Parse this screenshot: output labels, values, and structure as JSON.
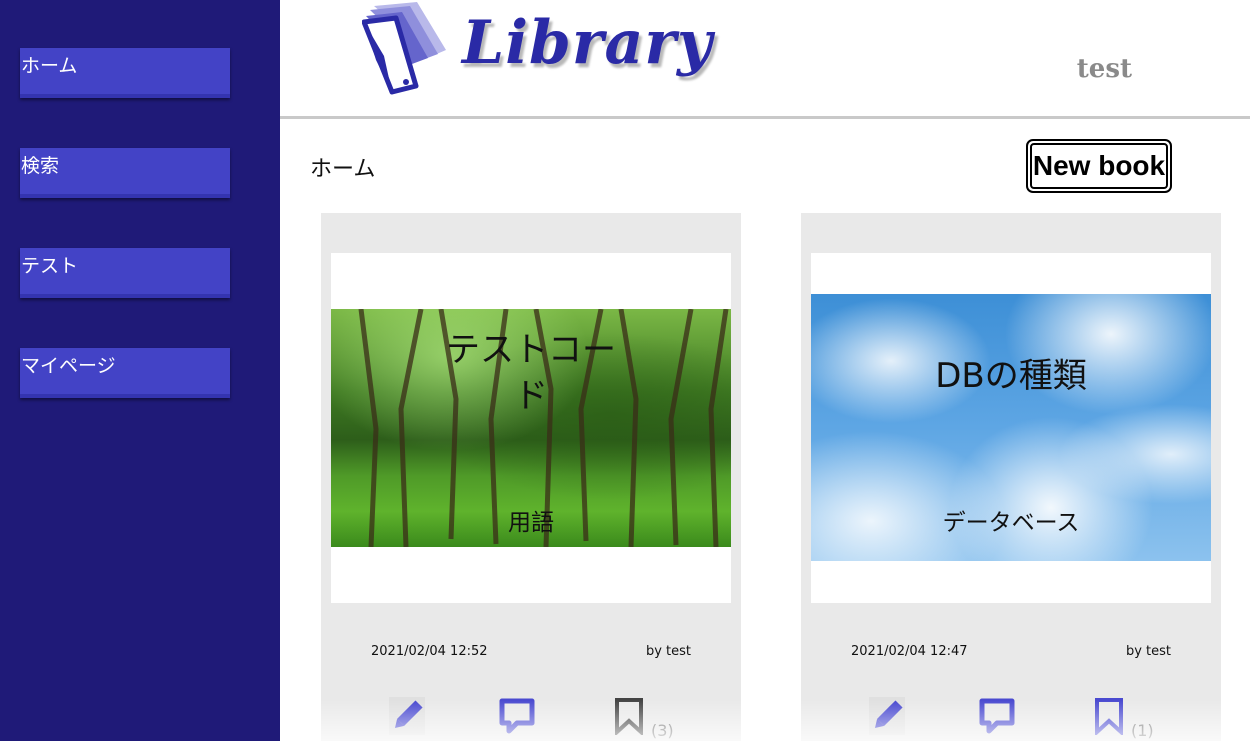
{
  "sidebar": {
    "items": [
      {
        "label": "ホーム"
      },
      {
        "label": "検索"
      },
      {
        "label": "テスト"
      },
      {
        "label": "マイページ"
      }
    ]
  },
  "header": {
    "logo_text": "Library",
    "username": "test"
  },
  "main": {
    "page_title": "ホーム",
    "new_book_label": "New book",
    "cards": [
      {
        "title": "テストコード",
        "subtitle": "用語",
        "cover": "forest-image",
        "date": "2021/02/04 12:52",
        "author": "by test",
        "bookmark_count": "(3)"
      },
      {
        "title": "DBの種類",
        "subtitle": "データベース",
        "cover": "sky-image",
        "date": "2021/02/04 12:47",
        "author": "by test",
        "bookmark_count": "(1)"
      }
    ]
  },
  "colors": {
    "sidebar_bg": "#1f1a78",
    "nav_item_bg": "#4343c6",
    "icon_blue": "#4a4ad0",
    "card_bg": "#e9e9e9"
  },
  "icons": {
    "edit": "pencil-icon",
    "comment": "comment-icon",
    "bookmark": "bookmark-icon"
  }
}
